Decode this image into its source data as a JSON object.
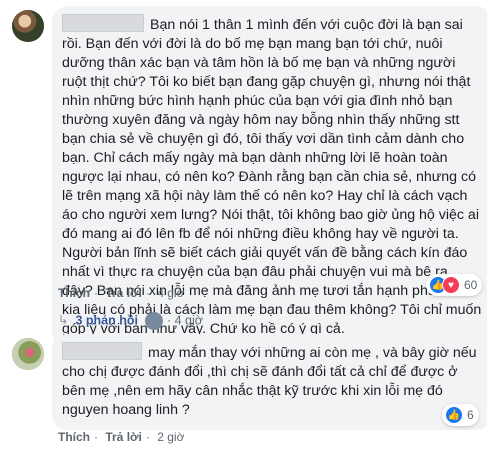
{
  "comment1": {
    "text": "Bạn nói 1 thân 1 mình đến với cuộc đời là bạn sai rồi. Bạn đến với đời là do bố mẹ bạn mang bạn tới chứ, nuôi dưỡng thân xác bạn và tâm hồn là bố mẹ bạn và những người ruột thịt chứ? Tôi ko biết bạn đang gặp chuyện gì, nhưng nói thật nhìn những bức hình hạnh phúc của bạn với gia đình nhỏ bạn thường xuyên đăng và ngày hôm nay bỗng nhìn thấy những stt bạn chia sẻ về chuyện gì đó, tôi thấy vơi dần tình cảm dành cho bạn. Chỉ cách mấy ngày mà bạn dành những lời lẽ hoàn toàn ngược lại nhau, có nên ko? Đành rằng bạn cần chia sẻ, nhưng có lẽ trên mạng xã hội này làm thế có nên ko? Hay chỉ là cách vạch áo cho người xem lưng? Nói thật, tôi không bao giờ ủng hộ việc ai đó mang ai đó lên fb để nói những điều không hay về người ta. Người bản lĩnh sẽ biết cách giải quyết vấn đề bằng cách kín đáo nhất vì thực ra chuyện của bạn đâu phải chuyện vui mà bê ra đây? Bạn nói xin lỗi mẹ mà đăng ảnh mẹ tươi tắn hạnh phúc như kia liệu có phải là cách làm mẹ bạn đau thêm không? Tôi chỉ muốn góp ý với bạn như vậy. Chứ ko hề có ý gì cả.",
    "actions": {
      "like": "Thích",
      "reply": "Trả lời",
      "time": "4 giờ"
    },
    "reaction_count": "60",
    "replies_label": "3 phản hồi",
    "replies_time": "4 giờ"
  },
  "comment2": {
    "text": "may mắn thay với những ai còn mẹ , và bây giờ nếu cho chị được đánh đổi ,thì chị sẽ đánh đổi tất cả chỉ để được ở bên mẹ ,nên em hãy cân nhắc thật kỹ trước khi xin lỗi mẹ đó nguyen hoang linh ?",
    "actions": {
      "like": "Thích",
      "reply": "Trả lời",
      "time": "2 giờ"
    },
    "reaction_count": "6"
  },
  "colors": {
    "bubble": "#f2f3f5",
    "link": "#365899",
    "meta": "#606770",
    "like": "#1877f2",
    "love": "#f33e58"
  },
  "icons": [
    "like-icon",
    "love-icon",
    "reply-arrow-icon"
  ]
}
